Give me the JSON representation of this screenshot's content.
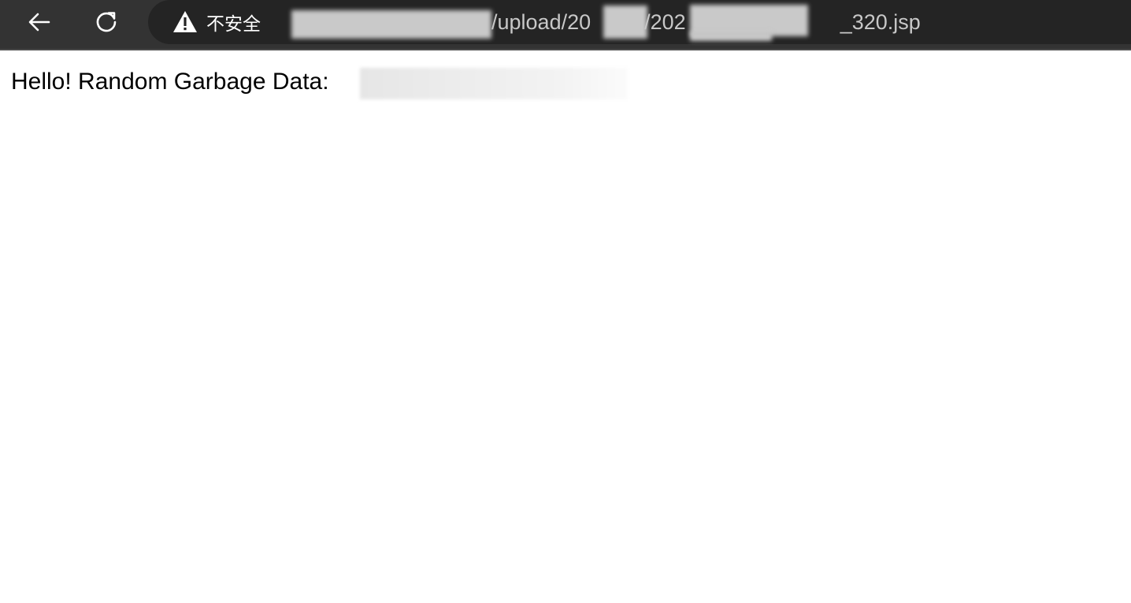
{
  "browser": {
    "back_icon": "arrow-left-icon",
    "reload_icon": "reload-icon",
    "security": {
      "icon": "warning-triangle-icon",
      "label": "不安全"
    },
    "url_segments": [
      "/upload/20",
      "/202",
      "_320.jsp"
    ],
    "colors": {
      "toolbar": "#333333",
      "omnibox": "#242424",
      "url_text": "#c8c8c8"
    }
  },
  "page": {
    "text": "Hello! Random Garbage Data:"
  }
}
